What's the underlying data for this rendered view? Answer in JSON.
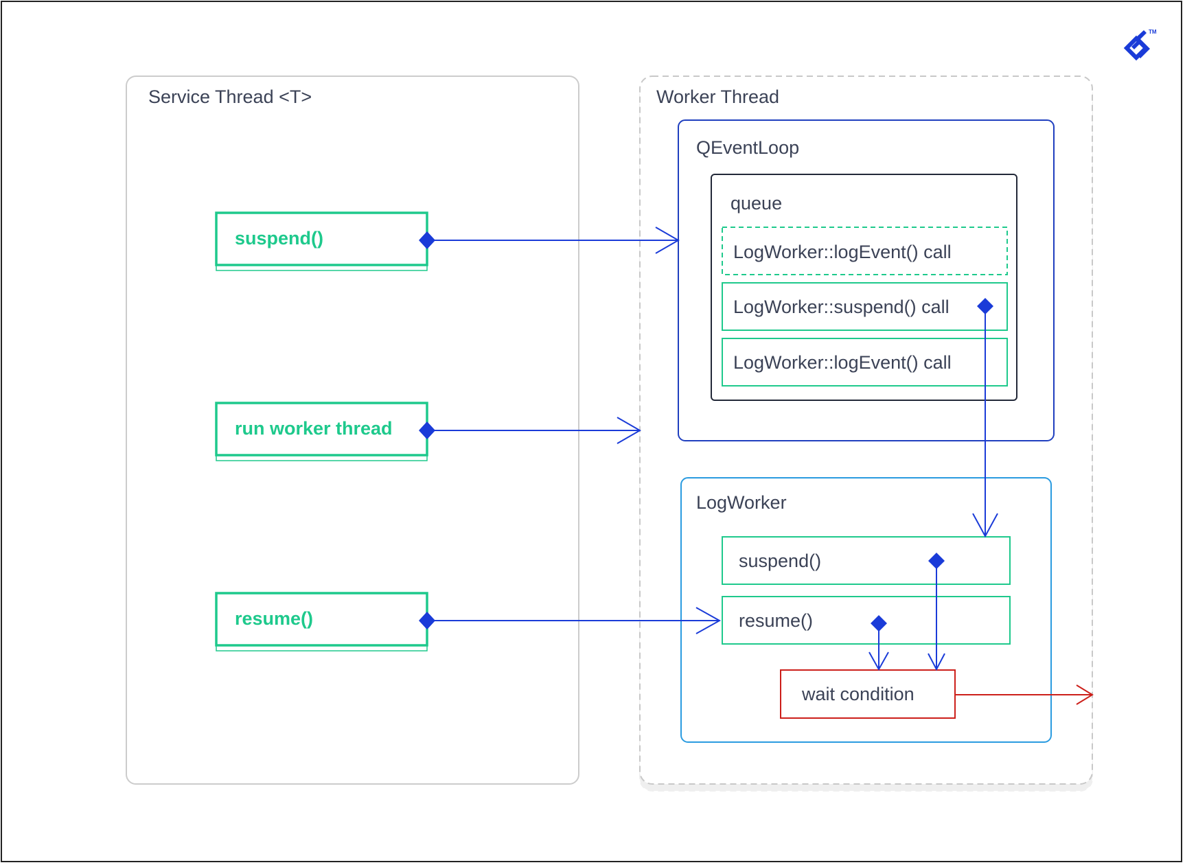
{
  "logo": {
    "icon": "toptal-logo-icon",
    "trademark": "TM",
    "color": "#1a3bd8"
  },
  "colors": {
    "text": "#3b4256",
    "green": "#1ec98c",
    "arrow_blue": "#1a3bd8",
    "event_loop_blue": "#1f3fbf",
    "log_worker_blue": "#2a9be0",
    "red": "#cc1f1a",
    "service_border": "#cccccc",
    "worker_border": "#c8c8c8"
  },
  "service_thread": {
    "title": "Service Thread <T>",
    "buttons": [
      {
        "label": "suspend()"
      },
      {
        "label": "run worker thread"
      },
      {
        "label": "resume()"
      }
    ]
  },
  "worker_thread": {
    "title": "Worker Thread",
    "event_loop": {
      "title": "QEventLoop",
      "queue": {
        "title": "queue",
        "items": [
          {
            "label": "LogWorker::logEvent() call",
            "style": "dashed"
          },
          {
            "label": "LogWorker::suspend() call",
            "style": "solid"
          },
          {
            "label": "LogWorker::logEvent() call",
            "style": "solid"
          }
        ]
      }
    },
    "log_worker": {
      "title": "LogWorker",
      "methods": [
        {
          "label": "suspend()"
        },
        {
          "label": "resume()"
        }
      ],
      "wait_condition": {
        "label": "wait condition"
      }
    }
  }
}
